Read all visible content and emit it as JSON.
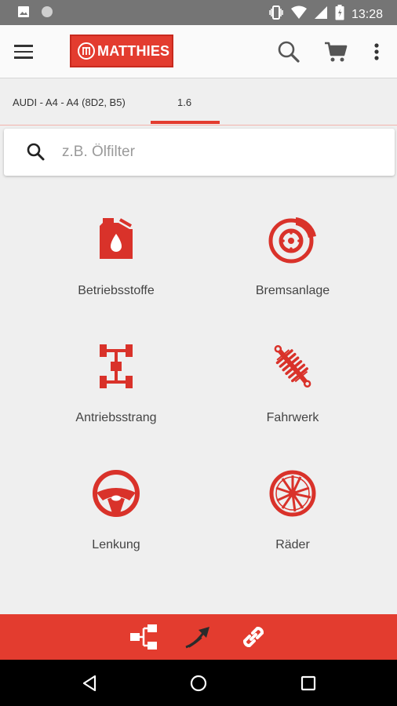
{
  "status_bar": {
    "time": "13:28",
    "icons": [
      "image-icon",
      "dot-icon",
      "vibrate-icon",
      "wifi-icon",
      "signal-icon",
      "battery-icon"
    ]
  },
  "app_bar": {
    "logo_text": "MATTHIES",
    "icons": [
      "menu-icon",
      "search-icon",
      "cart-icon",
      "more-vert-icon"
    ]
  },
  "tabs": [
    {
      "label": "AUDI - A4 - A4 (8D2, B5)",
      "active": false
    },
    {
      "label": "1.6",
      "active": true
    }
  ],
  "search": {
    "placeholder": "z.B. Ölfilter"
  },
  "categories": [
    {
      "label": "Betriebsstoffe",
      "icon": "oil-canister-icon"
    },
    {
      "label": "Bremsanlage",
      "icon": "brake-disc-icon"
    },
    {
      "label": "Antriebsstrang",
      "icon": "drivetrain-icon"
    },
    {
      "label": "Fahrwerk",
      "icon": "shock-absorber-icon"
    },
    {
      "label": "Lenkung",
      "icon": "steering-wheel-icon"
    },
    {
      "label": "Räder",
      "icon": "wheel-rim-icon"
    }
  ],
  "bottom_bar": {
    "icons": [
      "share-icon",
      "arrow-icon",
      "link-icon"
    ]
  },
  "nav_bar": {
    "icons": [
      "back-icon",
      "home-icon",
      "recents-icon"
    ]
  },
  "colors": {
    "accent": "#e33c2f",
    "status_bar": "#757575",
    "nav_bar": "#000000",
    "background": "#efefef"
  }
}
